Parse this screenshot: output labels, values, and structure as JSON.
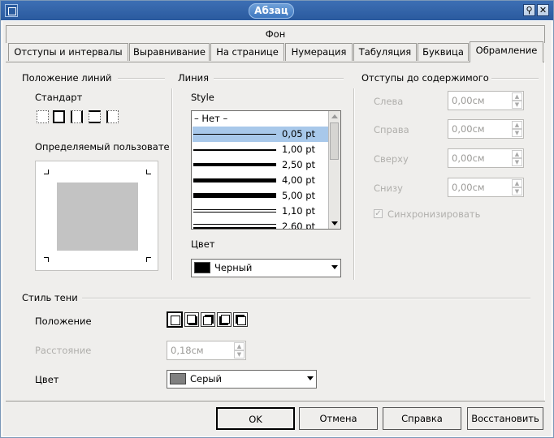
{
  "window": {
    "title": "Абзац"
  },
  "tabs": {
    "top_row": [
      "Фон"
    ],
    "second_row": [
      "Отступы и интервалы",
      "Выравнивание",
      "На странице",
      "Нумерация",
      "Табуляция",
      "Буквица",
      "Обрамление"
    ],
    "active": "Обрамление"
  },
  "line_arrangement": {
    "title": "Положение линий",
    "default_label": "Стандарт",
    "user_defined_label": "Определяемый пользовате"
  },
  "line": {
    "title": "Линия",
    "style_label": "Style",
    "styles": [
      "– Нет –",
      "0,05 pt",
      "1,00 pt",
      "2,50 pt",
      "4,00 pt",
      "5,00 pt",
      "1,10 pt",
      "2,60 pt"
    ],
    "selected_style": "0,05 pt",
    "color_label": "Цвет",
    "color_value": "Черный",
    "color_hex": "#000000"
  },
  "spacing": {
    "title": "Отступы до содержимого",
    "left_label": "Слева",
    "left_value": "0,00см",
    "right_label": "Справа",
    "right_value": "0,00см",
    "top_label": "Сверху",
    "top_value": "0,00см",
    "bottom_label": "Снизу",
    "bottom_value": "0,00см",
    "sync_label": "Синхронизировать",
    "sync_checked": true
  },
  "shadow": {
    "title": "Стиль тени",
    "position_label": "Положение",
    "distance_label": "Расстояние",
    "distance_value": "0,18см",
    "color_label": "Цвет",
    "color_value": "Серый",
    "color_hex": "#808080"
  },
  "buttons": {
    "ok": "OK",
    "cancel": "Отмена",
    "help": "Справка",
    "reset": "Восстановить"
  }
}
